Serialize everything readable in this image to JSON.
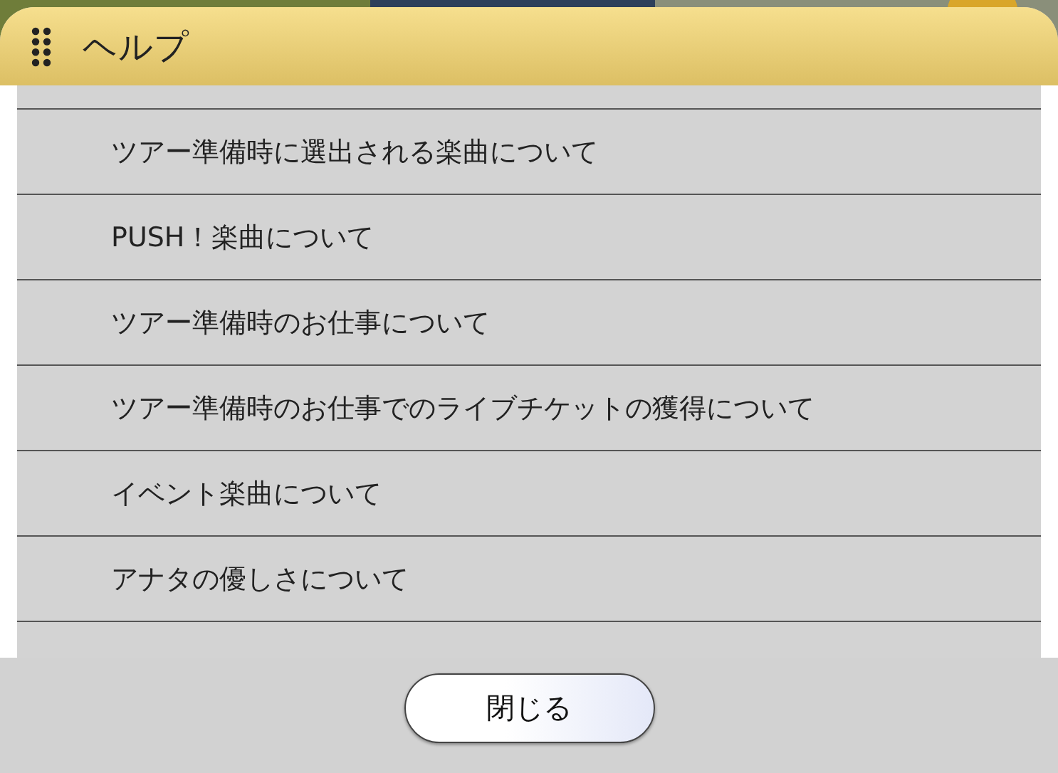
{
  "dialog": {
    "title": "ヘルプ"
  },
  "help_items": [
    {
      "label": "ツアー準備時に選出される楽曲について"
    },
    {
      "label": "PUSH！楽曲について"
    },
    {
      "label": "ツアー準備時のお仕事について"
    },
    {
      "label": "ツアー準備時のお仕事でのライブチケットの獲得について"
    },
    {
      "label": "イベント楽曲について"
    },
    {
      "label": "アナタの優しさについて"
    }
  ],
  "buttons": [
    {
      "label": "閉じる"
    }
  ]
}
